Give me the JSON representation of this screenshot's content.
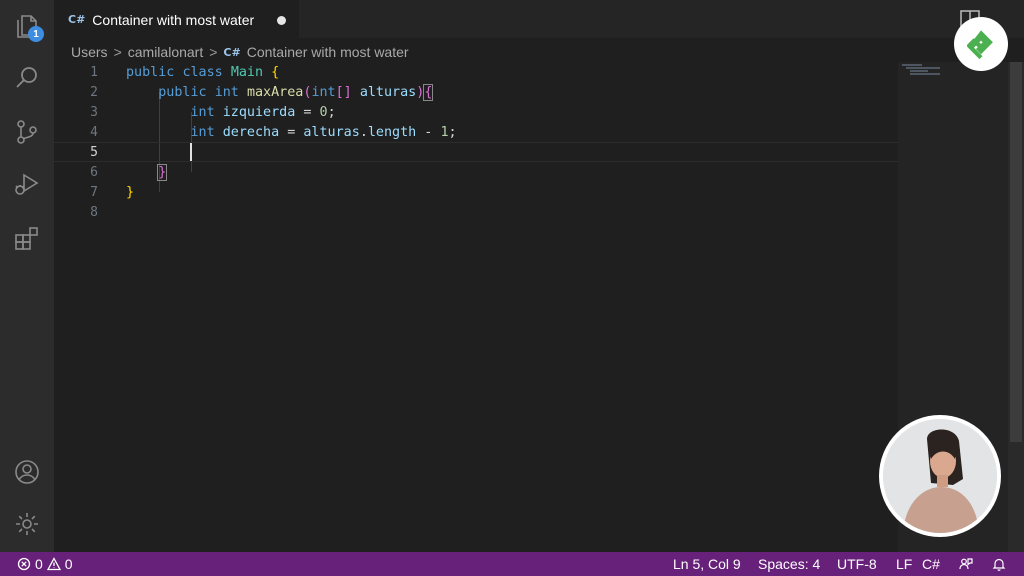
{
  "activity_bar": {
    "explorer_badge": "1",
    "icons": [
      "files-icon",
      "search-icon",
      "source-control-icon",
      "run-debug-icon",
      "extensions-icon",
      "account-icon",
      "settings-gear-icon"
    ]
  },
  "tab": {
    "file_type_glyph": "C#",
    "title": "Container with most water"
  },
  "breadcrumb": {
    "segments": [
      "Users",
      "camilalonart"
    ],
    "separator": ">",
    "file_glyph": "C#",
    "file": "Container with most water"
  },
  "editor": {
    "line_numbers": [
      "1",
      "2",
      "3",
      "4",
      "5",
      "6",
      "7",
      "8"
    ],
    "active_line": "5"
  },
  "status_bar": {
    "errors": "0",
    "warnings": "0",
    "position": "Ln 5, Col 9",
    "spaces": "Spaces: 4",
    "encoding": "UTF-8",
    "eol": "LF",
    "language": "C#"
  },
  "colors": {
    "status_bar": "#68217a",
    "keyword": "#569cd6",
    "class_name": "#4ec9b0",
    "function_name": "#dcdcaa",
    "variable": "#9cdcfe",
    "number": "#b5cea8",
    "badge": "#3d8ee0",
    "logo_green": "#4caf50"
  }
}
